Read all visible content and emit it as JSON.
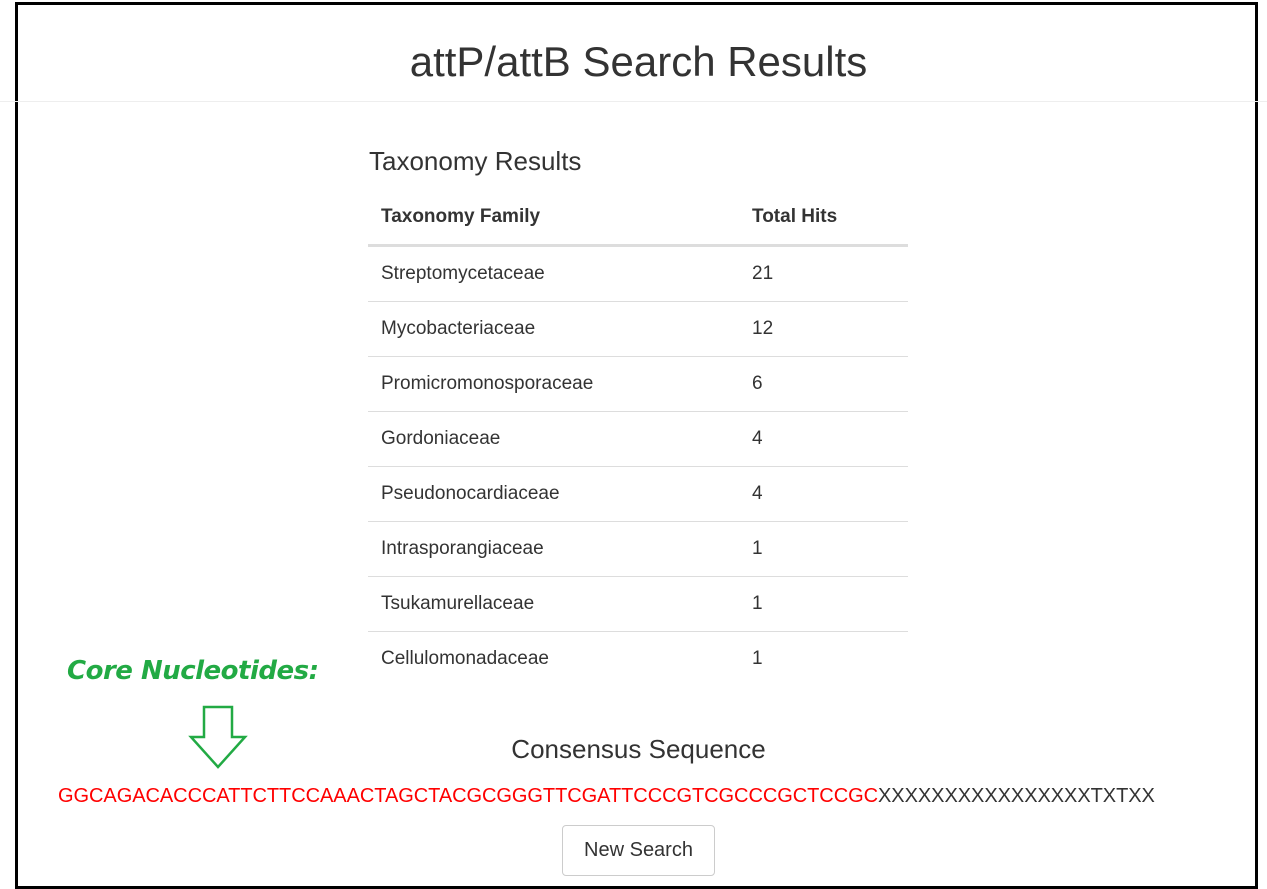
{
  "header": {
    "title": "attP/attB Search Results"
  },
  "taxonomy": {
    "title": "Taxonomy Results",
    "columns": [
      "Taxonomy Family",
      "Total Hits"
    ],
    "rows": [
      [
        "Streptomycetaceae",
        "21"
      ],
      [
        "Mycobacteriaceae",
        "12"
      ],
      [
        "Promicromonosporaceae",
        "6"
      ],
      [
        "Gordoniaceae",
        "4"
      ],
      [
        "Pseudonocardiaceae",
        "4"
      ],
      [
        "Intrasporangiaceae",
        "1"
      ],
      [
        "Tsukamurellaceae",
        "1"
      ],
      [
        "Cellulomonadaceae",
        "1"
      ]
    ]
  },
  "annotation": {
    "label": "Core Nucleotides:",
    "color": "#22aa44",
    "icon": "down-arrow-icon"
  },
  "consensus": {
    "title": "Consensus Sequence",
    "core": "GGCAGACACCCATTCTTCCAAACTAGCTACGCGGGTTCGATTCCCGTCGCCCGCTCCGC",
    "rest": "XXXXXXXXXXXXXXXXTXTXX",
    "core_color": "#ff0000"
  },
  "actions": {
    "new_search_label": "New Search"
  }
}
